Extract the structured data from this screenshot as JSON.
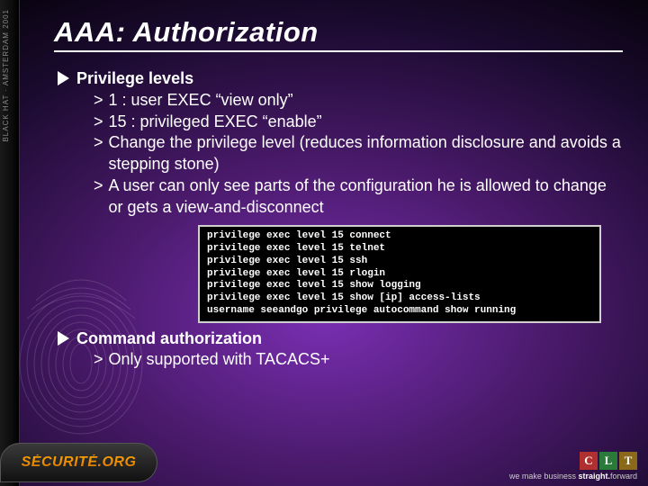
{
  "leftStrip": "BLACK HAT · AMSTERDAM 2001",
  "title": "AAA: Authorization",
  "section1": {
    "heading": "Privilege levels",
    "items": [
      "1   : user EXEC “view only”",
      "15 : privileged EXEC “enable”",
      "Change the privilege level (reduces information disclosure and avoids a stepping stone)",
      "A user can only see parts of the configuration he is allowed to change or gets a view-and-disconnect"
    ]
  },
  "code": "privilege exec level 15 connect\nprivilege exec level 15 telnet\nprivilege exec level 15 ssh\nprivilege exec level 15 rlogin\nprivilege exec level 15 show logging\nprivilege exec level 15 show [ip] access-lists\nusername seeandgo privilege autocommand show running",
  "section2": {
    "heading": "Command authorization",
    "items": [
      "Only supported with TACACS+"
    ]
  },
  "logos": {
    "securite": "SÉCURITÉ.ORG",
    "clt": {
      "c": "C",
      "l": "L",
      "t": "T"
    },
    "tagline_pre": "we make business ",
    "tagline_bold": "straight.",
    "tagline_post": "forward"
  }
}
